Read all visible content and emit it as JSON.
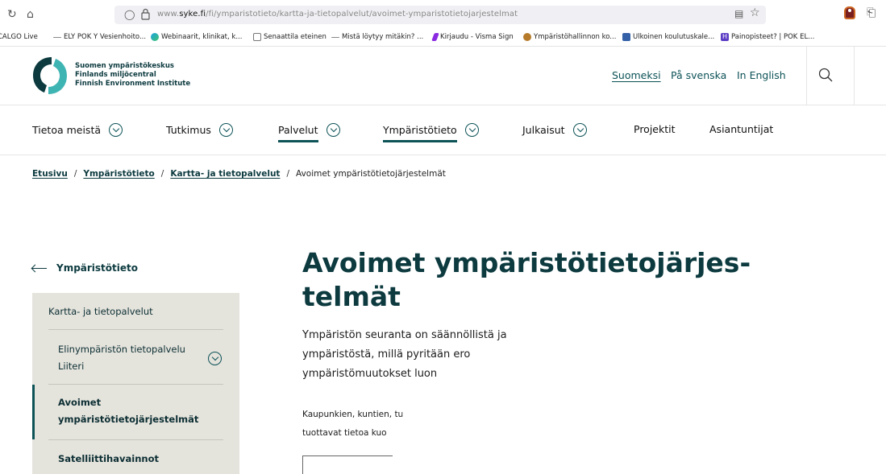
{
  "browser": {
    "url_prefix": "www.",
    "url_domain": "syke.fi",
    "url_path": "/fi/ymparistotieto/kartta-ja-tietopalvelut/avoimet-ymparistotietojarjestelmat",
    "reload_icon": "reload-icon",
    "home_icon": "home-icon",
    "bookmarks": [
      {
        "label": "CALGO Live",
        "icon": "none"
      },
      {
        "label": "ELY POK Y Vesienhoito...",
        "icon": "dash"
      },
      {
        "label": "Webinaarit, klinikat, k...",
        "icon": "edge"
      },
      {
        "label": "Senaattila eteinen",
        "icon": "doc"
      },
      {
        "label": "Mistä löytyy mitäkin? ...",
        "icon": "dash"
      },
      {
        "label": "Kirjaudu - Visma Sign",
        "icon": "visma"
      },
      {
        "label": "Ympäristöhallinnon ko...",
        "icon": "lion"
      },
      {
        "label": "Ulkoinen koulutuskale...",
        "icon": "uk"
      },
      {
        "label": "Painopisteet? | POK EL...",
        "icon": "h"
      }
    ]
  },
  "header": {
    "logo_lines": [
      "Suomen ympäristökeskus",
      "Finlands miljöcentral",
      "Finnish Environment Institute"
    ],
    "languages": {
      "fi": "Suomeksi",
      "sv": "På svenska",
      "en": "In English"
    },
    "colors": {
      "brand_dark": "#0c3a3f",
      "brand_teal": "#0c5257",
      "logo_teal": "#3fb5b3",
      "side_bg": "#e4e3dc"
    }
  },
  "nav": {
    "items": [
      {
        "label": "Tietoa meistä",
        "dropdown": true,
        "active": false
      },
      {
        "label": "Tutkimus",
        "dropdown": true,
        "active": false
      },
      {
        "label": "Palvelut",
        "dropdown": true,
        "active": true
      },
      {
        "label": "Ympäristötieto",
        "dropdown": true,
        "active": true
      },
      {
        "label": "Julkaisut",
        "dropdown": true,
        "active": false
      },
      {
        "label": "Projektit",
        "dropdown": false,
        "active": false
      },
      {
        "label": "Asiantuntijat",
        "dropdown": false,
        "active": false
      }
    ]
  },
  "breadcrumb": {
    "items": [
      "Etusivu",
      "Ympäristötieto",
      "Kartta- ja tietopalvelut"
    ],
    "current": "Avoimet ympäristötietojärjestelmät",
    "separator": "/"
  },
  "sidebar": {
    "back_label": "Ympäristötieto",
    "items": [
      {
        "label": "Kartta- ja tietopalvelut"
      },
      {
        "label_lines": [
          "Elinympäristön tietopalvelu",
          "Liiteri"
        ],
        "expandable": true
      },
      {
        "label_lines": [
          "Avoimet",
          "ympäristötietojärjestelmät"
        ],
        "active": true
      },
      {
        "label": "Satelliittihavainnot"
      }
    ]
  },
  "content": {
    "title_lines": [
      "Avoimet ympäristötietojärjes-",
      "telmät"
    ],
    "lead_lines": [
      "Ympäristön seuranta on säännöllistä ja",
      "ympäristöstä, millä pyritään ero",
      "ympäristömuutokset luon"
    ],
    "body_lines": [
      "Kaupunkien, kuntien, tu",
      "tuottavat tietoa kuo"
    ]
  }
}
